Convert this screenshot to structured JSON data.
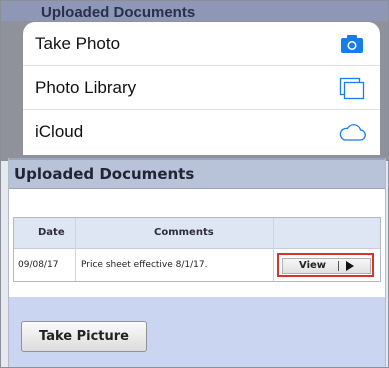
{
  "background": {
    "title": "Uploaded Documents"
  },
  "action_sheet": {
    "items": [
      {
        "label": "Take Photo",
        "icon": "camera-icon"
      },
      {
        "label": "Photo Library",
        "icon": "photo-library-icon"
      },
      {
        "label": "iCloud",
        "icon": "cloud-icon"
      }
    ],
    "accent": "#1a7ce6"
  },
  "panel": {
    "title": "Uploaded Documents",
    "table": {
      "headers": [
        "Date",
        "Comments"
      ],
      "rows": [
        {
          "date": "09/08/17",
          "comment": "Price sheet effective 8/1/17.",
          "action": "View"
        }
      ]
    },
    "take_picture_label": "Take Picture"
  },
  "colors": {
    "highlight": "#d9322f",
    "header_bg": "#b8c3da",
    "lower_bg": "#c9d5f1"
  }
}
